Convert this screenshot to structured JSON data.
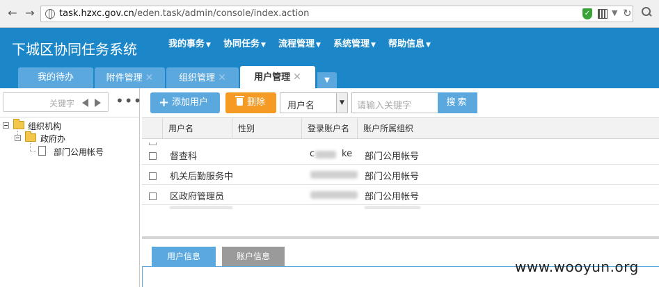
{
  "browser": {
    "url_host": "task.hzxc.gov.cn",
    "url_path": "/eden.task/admin/console/index.action"
  },
  "app": {
    "title": "下城区协同任务系统",
    "menu": [
      {
        "label": "我的事务"
      },
      {
        "label": "协同任务"
      },
      {
        "label": "流程管理"
      },
      {
        "label": "系统管理"
      },
      {
        "label": "帮助信息"
      }
    ],
    "tabs": [
      {
        "label": "我的待办",
        "closable": false,
        "active": false
      },
      {
        "label": "附件管理",
        "closable": true,
        "active": false
      },
      {
        "label": "组织管理",
        "closable": true,
        "active": false
      },
      {
        "label": "用户管理",
        "closable": true,
        "active": true
      }
    ]
  },
  "left_panel": {
    "search_placeholder": "关键字",
    "tree": [
      {
        "label": "组织机构",
        "level": 0
      },
      {
        "label": "政府办",
        "level": 1
      },
      {
        "label": "部门公用帐号",
        "level": 2
      }
    ]
  },
  "toolbar": {
    "add_label": "添加用户",
    "delete_label": "删除",
    "field_select_value": "用户名",
    "keyword_placeholder": "请输入关键字",
    "search_label": "搜索"
  },
  "grid": {
    "columns": [
      "用户名",
      "性别",
      "登录账户名",
      "账户所属组织"
    ],
    "rows": [
      {
        "name": "督查科",
        "gender": "",
        "login_prefix": "c",
        "login_suffix": "ke",
        "org": "部门公用帐号"
      },
      {
        "name": "机关后勤服务中",
        "gender": "",
        "login_prefix": "",
        "login_suffix": "",
        "org": "部门公用帐号"
      },
      {
        "name": "区政府管理员",
        "gender": "",
        "login_prefix": "",
        "login_suffix": "",
        "org": "部门公用帐号"
      }
    ]
  },
  "bottom_tabs": [
    {
      "label": "用户信息"
    },
    {
      "label": "账户信息"
    }
  ],
  "watermark": "www.wooyun.org",
  "colors": {
    "header": "#1b87c9",
    "tab": "#5ba8de",
    "delete": "#f59a23"
  }
}
